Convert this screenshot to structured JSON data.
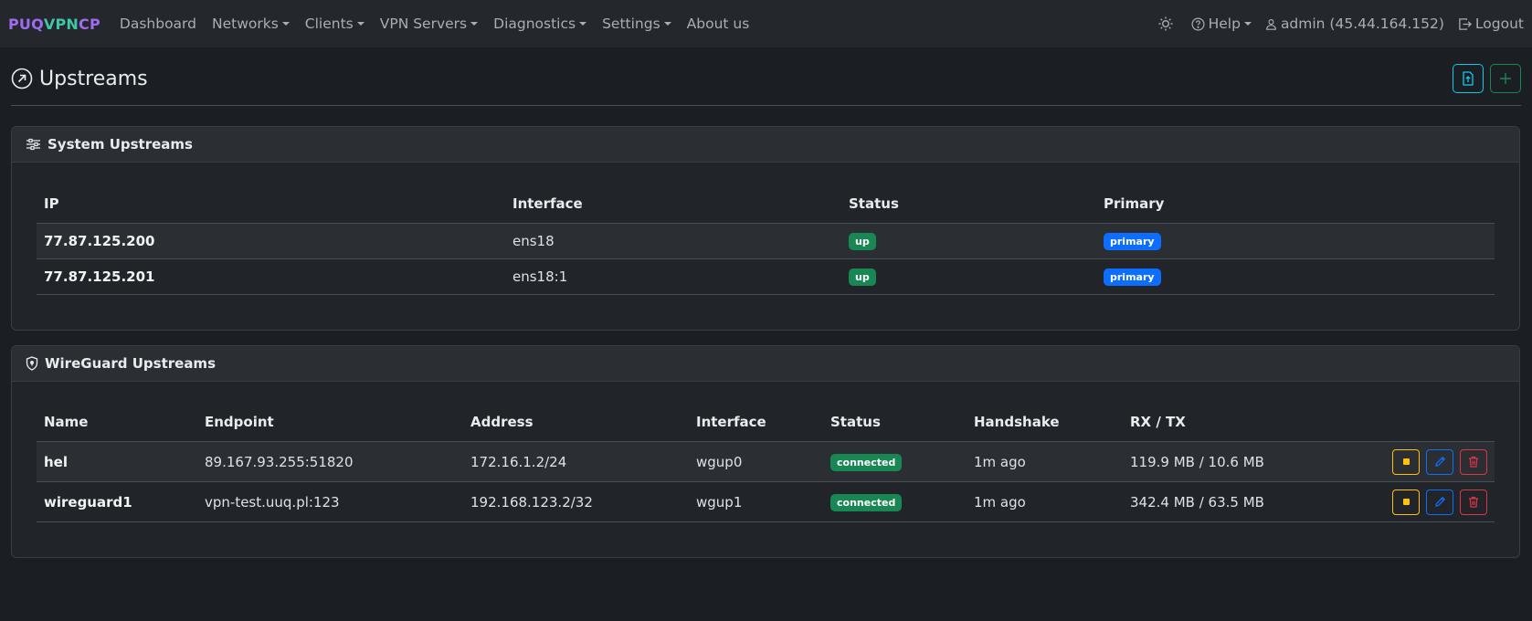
{
  "brand": {
    "part1": "PUQ",
    "part2": "VPN",
    "part3": "CP"
  },
  "nav": {
    "items": [
      {
        "label": "Dashboard",
        "dropdown": false
      },
      {
        "label": "Networks",
        "dropdown": true
      },
      {
        "label": "Clients",
        "dropdown": true
      },
      {
        "label": "VPN Servers",
        "dropdown": true
      },
      {
        "label": "Diagnostics",
        "dropdown": true
      },
      {
        "label": "Settings",
        "dropdown": true
      },
      {
        "label": "About us",
        "dropdown": false
      }
    ],
    "help_label": "Help",
    "user_label": "admin (45.44.164.152)",
    "logout_label": "Logout"
  },
  "page": {
    "title": "Upstreams"
  },
  "system_upstreams": {
    "title": "System Upstreams",
    "columns": [
      "IP",
      "Interface",
      "Status",
      "Primary"
    ],
    "rows": [
      {
        "ip": "77.87.125.200",
        "interface": "ens18",
        "status": "up",
        "primary": "primary"
      },
      {
        "ip": "77.87.125.201",
        "interface": "ens18:1",
        "status": "up",
        "primary": "primary"
      }
    ]
  },
  "wireguard_upstreams": {
    "title": "WireGuard Upstreams",
    "columns": [
      "Name",
      "Endpoint",
      "Address",
      "Interface",
      "Status",
      "Handshake",
      "RX / TX",
      ""
    ],
    "rows": [
      {
        "name": "hel",
        "endpoint": "89.167.93.255:51820",
        "address": "172.16.1.2/24",
        "interface": "wgup0",
        "status": "connected",
        "handshake": "1m ago",
        "rxtx": "119.9 MB / 10.6 MB"
      },
      {
        "name": "wireguard1",
        "endpoint": "vpn-test.uuq.pl:123",
        "address": "192.168.123.2/32",
        "interface": "wgup1",
        "status": "connected",
        "handshake": "1m ago",
        "rxtx": "342.4 MB / 63.5 MB"
      }
    ]
  },
  "colors": {
    "accent_purple": "#9d6cf0",
    "accent_teal": "#3fc7a5",
    "success": "#198754",
    "primary": "#0d6efd",
    "info": "#0dcaf0",
    "warning": "#ffc107",
    "danger": "#dc3545"
  }
}
